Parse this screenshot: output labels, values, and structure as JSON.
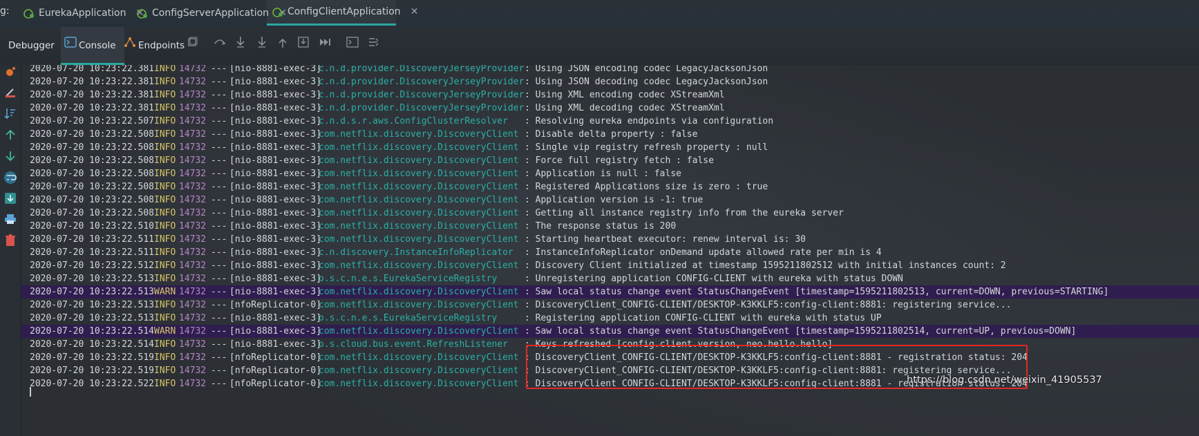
{
  "tabbar": {
    "prefix": "g:",
    "tabs": [
      {
        "label": "EurekaApplication",
        "close": "✕",
        "active": false
      },
      {
        "label": "ConfigServerApplication",
        "close": "✕",
        "active": false
      },
      {
        "label": "ConfigClientApplication",
        "close": "✕",
        "active": true
      }
    ]
  },
  "toolbar": {
    "debugger_label": "Debugger",
    "console_label": "Console",
    "endpoints_label": "Endpoints"
  },
  "icons": {
    "app": "spring-app-icon",
    "console": "console-icon",
    "endpoints": "endpoints-icon"
  },
  "colors": {
    "accent": "#2aa8a0",
    "info": "#d7c56a",
    "pid": "#b684c8",
    "logger": "#2bb0a6",
    "warn_row": "#2f1d4f",
    "highlight": "#e02a22"
  },
  "log": {
    "lines": [
      {
        "ts": "2020-07-20 10:23:22.381",
        "level": "INFO",
        "pid": "14732",
        "sep": "---",
        "thread": "[nio-8881-exec-3]",
        "logger": "c.n.d.provider.DiscoveryJerseyProvider",
        "msg": ": Using JSON encoding codec LegacyJacksonJson"
      },
      {
        "ts": "2020-07-20 10:23:22.381",
        "level": "INFO",
        "pid": "14732",
        "sep": "---",
        "thread": "[nio-8881-exec-3]",
        "logger": "c.n.d.provider.DiscoveryJerseyProvider",
        "msg": ": Using JSON decoding codec LegacyJacksonJson"
      },
      {
        "ts": "2020-07-20 10:23:22.381",
        "level": "INFO",
        "pid": "14732",
        "sep": "---",
        "thread": "[nio-8881-exec-3]",
        "logger": "c.n.d.provider.DiscoveryJerseyProvider",
        "msg": ": Using XML encoding codec XStreamXml"
      },
      {
        "ts": "2020-07-20 10:23:22.381",
        "level": "INFO",
        "pid": "14732",
        "sep": "---",
        "thread": "[nio-8881-exec-3]",
        "logger": "c.n.d.provider.DiscoveryJerseyProvider",
        "msg": ": Using XML decoding codec XStreamXml"
      },
      {
        "ts": "2020-07-20 10:23:22.507",
        "level": "INFO",
        "pid": "14732",
        "sep": "---",
        "thread": "[nio-8881-exec-3]",
        "logger": "c.n.d.s.r.aws.ConfigClusterResolver",
        "msg": ": Resolving eureka endpoints via configuration"
      },
      {
        "ts": "2020-07-20 10:23:22.508",
        "level": "INFO",
        "pid": "14732",
        "sep": "---",
        "thread": "[nio-8881-exec-3]",
        "logger": "com.netflix.discovery.DiscoveryClient",
        "msg": ": Disable delta property : false"
      },
      {
        "ts": "2020-07-20 10:23:22.508",
        "level": "INFO",
        "pid": "14732",
        "sep": "---",
        "thread": "[nio-8881-exec-3]",
        "logger": "com.netflix.discovery.DiscoveryClient",
        "msg": ": Single vip registry refresh property : null"
      },
      {
        "ts": "2020-07-20 10:23:22.508",
        "level": "INFO",
        "pid": "14732",
        "sep": "---",
        "thread": "[nio-8881-exec-3]",
        "logger": "com.netflix.discovery.DiscoveryClient",
        "msg": ": Force full registry fetch : false"
      },
      {
        "ts": "2020-07-20 10:23:22.508",
        "level": "INFO",
        "pid": "14732",
        "sep": "---",
        "thread": "[nio-8881-exec-3]",
        "logger": "com.netflix.discovery.DiscoveryClient",
        "msg": ": Application is null : false"
      },
      {
        "ts": "2020-07-20 10:23:22.508",
        "level": "INFO",
        "pid": "14732",
        "sep": "---",
        "thread": "[nio-8881-exec-3]",
        "logger": "com.netflix.discovery.DiscoveryClient",
        "msg": ": Registered Applications size is zero : true"
      },
      {
        "ts": "2020-07-20 10:23:22.508",
        "level": "INFO",
        "pid": "14732",
        "sep": "---",
        "thread": "[nio-8881-exec-3]",
        "logger": "com.netflix.discovery.DiscoveryClient",
        "msg": ": Application version is -1: true"
      },
      {
        "ts": "2020-07-20 10:23:22.508",
        "level": "INFO",
        "pid": "14732",
        "sep": "---",
        "thread": "[nio-8881-exec-3]",
        "logger": "com.netflix.discovery.DiscoveryClient",
        "msg": ": Getting all instance registry info from the eureka server"
      },
      {
        "ts": "2020-07-20 10:23:22.510",
        "level": "INFO",
        "pid": "14732",
        "sep": "---",
        "thread": "[nio-8881-exec-3]",
        "logger": "com.netflix.discovery.DiscoveryClient",
        "msg": ": The response status is 200"
      },
      {
        "ts": "2020-07-20 10:23:22.511",
        "level": "INFO",
        "pid": "14732",
        "sep": "---",
        "thread": "[nio-8881-exec-3]",
        "logger": "com.netflix.discovery.DiscoveryClient",
        "msg": ": Starting heartbeat executor: renew interval is: 30"
      },
      {
        "ts": "2020-07-20 10:23:22.511",
        "level": "INFO",
        "pid": "14732",
        "sep": "---",
        "thread": "[nio-8881-exec-3]",
        "logger": "c.n.discovery.InstanceInfoReplicator",
        "msg": ": InstanceInfoReplicator onDemand update allowed rate per min is 4"
      },
      {
        "ts": "2020-07-20 10:23:22.512",
        "level": "INFO",
        "pid": "14732",
        "sep": "---",
        "thread": "[nio-8881-exec-3]",
        "logger": "com.netflix.discovery.DiscoveryClient",
        "msg": ": Discovery Client initialized at timestamp 1595211802512 with initial instances count: 2"
      },
      {
        "ts": "2020-07-20 10:23:22.513",
        "level": "INFO",
        "pid": "14732",
        "sep": "---",
        "thread": "[nio-8881-exec-3]",
        "logger": "o.s.c.n.e.s.EurekaServiceRegistry",
        "msg": ": Unregistering application CONFIG-CLIENT with eureka with status DOWN"
      },
      {
        "ts": "2020-07-20 10:23:22.513",
        "level": "WARN",
        "pid": "14732",
        "sep": "---",
        "thread": "[nio-8881-exec-3]",
        "logger": "com.netflix.discovery.DiscoveryClient",
        "msg": ": Saw local status change event StatusChangeEvent [timestamp=1595211802513, current=DOWN, previous=STARTING]"
      },
      {
        "ts": "2020-07-20 10:23:22.513",
        "level": "INFO",
        "pid": "14732",
        "sep": "---",
        "thread": "[nfoReplicator-0]",
        "logger": "com.netflix.discovery.DiscoveryClient",
        "msg": ": DiscoveryClient_CONFIG-CLIENT/DESKTOP-K3KKLF5:config-client:8881: registering service..."
      },
      {
        "ts": "2020-07-20 10:23:22.513",
        "level": "INFO",
        "pid": "14732",
        "sep": "---",
        "thread": "[nio-8881-exec-3]",
        "logger": "o.s.c.n.e.s.EurekaServiceRegistry",
        "msg": ": Registering application CONFIG-CLIENT with eureka with status UP"
      },
      {
        "ts": "2020-07-20 10:23:22.514",
        "level": "WARN",
        "pid": "14732",
        "sep": "---",
        "thread": "[nio-8881-exec-3]",
        "logger": "com.netflix.discovery.DiscoveryClient",
        "msg": ": Saw local status change event StatusChangeEvent [timestamp=1595211802514, current=UP, previous=DOWN]"
      },
      {
        "ts": "2020-07-20 10:23:22.514",
        "level": "INFO",
        "pid": "14732",
        "sep": "---",
        "thread": "[nio-8881-exec-3]",
        "logger": "o.s.cloud.bus.event.RefreshListener",
        "msg": ": Keys refreshed [config.client.version, neo.hello.hello]"
      },
      {
        "ts": "2020-07-20 10:23:22.519",
        "level": "INFO",
        "pid": "14732",
        "sep": "---",
        "thread": "[nfoReplicator-0]",
        "logger": "com.netflix.discovery.DiscoveryClient",
        "msg": ": DiscoveryClient_CONFIG-CLIENT/DESKTOP-K3KKLF5:config-client:8881 - registration status: 204"
      },
      {
        "ts": "2020-07-20 10:23:22.519",
        "level": "INFO",
        "pid": "14732",
        "sep": "---",
        "thread": "[nfoReplicator-0]",
        "logger": "com.netflix.discovery.DiscoveryClient",
        "msg": ": DiscoveryClient_CONFIG-CLIENT/DESKTOP-K3KKLF5:config-client:8881: registering service..."
      },
      {
        "ts": "2020-07-20 10:23:22.522",
        "level": "INFO",
        "pid": "14732",
        "sep": "---",
        "thread": "[nfoReplicator-0]",
        "logger": "com.netflix.discovery.DiscoveryClient",
        "msg": ": DiscoveryClient_CONFIG-CLIENT/DESKTOP-K3KKLF5:config-client:8881 - registration status: 204"
      }
    ]
  },
  "watermark": "https://blog.csdn.net/weixin_41905537"
}
